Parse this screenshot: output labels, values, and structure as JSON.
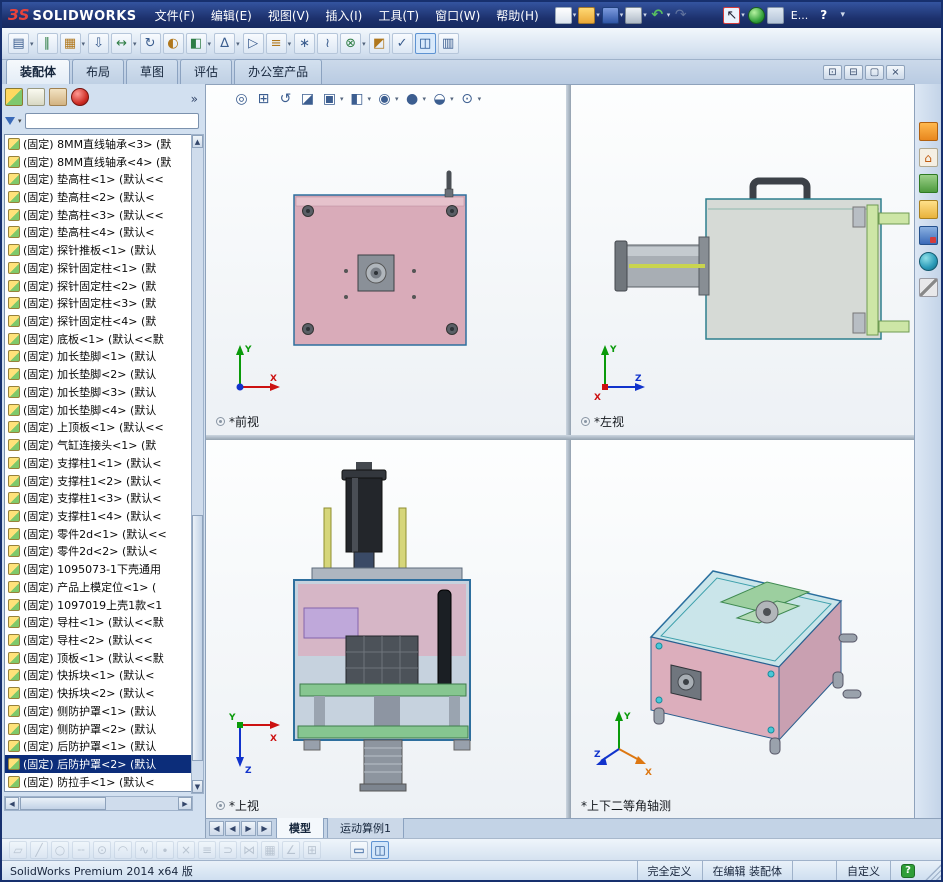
{
  "titlebar": {
    "logo_mark": "ЗS",
    "brand": "SOLIDWORKS",
    "menus": [
      "文件(F)",
      "编辑(E)",
      "视图(V)",
      "插入(I)",
      "工具(T)",
      "窗口(W)",
      "帮助(H)"
    ],
    "quick_icons": [
      {
        "name": "new-document-icon",
        "caret": "▾"
      },
      {
        "name": "open-icon",
        "caret": "▾"
      },
      {
        "name": "save-icon",
        "caret": "▾"
      },
      {
        "name": "print-icon",
        "caret": "▾"
      },
      {
        "name": "undo-icon",
        "glyph": "↶",
        "caret": "▾"
      },
      {
        "name": "redo-icon",
        "glyph": "↷",
        "disabled": true
      }
    ],
    "right_icons": [
      {
        "name": "select-arrow-icon",
        "glyph": "↖",
        "caret": "▾",
        "active": true
      },
      {
        "name": "rebuild-icon"
      },
      {
        "name": "view-settings-icon"
      }
    ],
    "overflow_label": "E...",
    "trailing_icons": [
      {
        "name": "help-icon",
        "glyph": "?"
      },
      {
        "name": "toolbar-flyout-icon",
        "glyph": "▾"
      }
    ]
  },
  "assembly_toolbar": {
    "icons": [
      {
        "name": "insert-components-icon",
        "glyph": "▤",
        "caret": "▾"
      },
      {
        "name": "mate-icon",
        "glyph": "∥"
      },
      {
        "name": "linear-component-pattern-icon",
        "glyph": "▦",
        "caret": "▾"
      },
      {
        "name": "smart-fasteners-icon",
        "glyph": "⇩"
      },
      {
        "name": "move-component-icon",
        "glyph": "↔",
        "caret": "▾"
      },
      {
        "name": "rotate-component-icon",
        "glyph": "↻"
      },
      {
        "name": "show-hidden-components-icon",
        "glyph": "◐"
      },
      {
        "name": "assembly-features-icon",
        "glyph": "◧",
        "caret": "▾"
      },
      {
        "name": "reference-geometry-icon",
        "glyph": "∆",
        "caret": "▾"
      },
      {
        "name": "new-motion-study-icon",
        "glyph": "▷"
      },
      {
        "name": "bill-of-materials-icon",
        "glyph": "≡",
        "caret": "▾"
      },
      {
        "name": "exploded-view-icon",
        "glyph": "∗"
      },
      {
        "name": "explode-line-sketch-icon",
        "glyph": "≀"
      },
      {
        "name": "interference-detection-icon",
        "glyph": "⊗",
        "caret": "▾"
      },
      {
        "name": "assembly-visualization-icon",
        "glyph": "◩"
      },
      {
        "name": "assembly-xpert-icon",
        "glyph": "✓"
      },
      {
        "name": "section-pane-icon",
        "glyph": "◫",
        "active": true
      },
      {
        "name": "pane-display-icon",
        "glyph": "▥"
      }
    ]
  },
  "ribbon_tabs": {
    "items": [
      {
        "label": "装配体",
        "active": true
      },
      {
        "label": "布局"
      },
      {
        "label": "草图"
      },
      {
        "label": "评估"
      },
      {
        "label": "办公室产品"
      }
    ]
  },
  "document_window": {
    "buttons": [
      {
        "name": "restore-window-icon",
        "glyph": "⊡"
      },
      {
        "name": "minimize-window-icon",
        "glyph": "⊟"
      },
      {
        "name": "maximize-window-icon",
        "glyph": "▢"
      },
      {
        "name": "close-window-icon",
        "glyph": "×"
      }
    ]
  },
  "feature_panel": {
    "tabs": [
      {
        "name": "featuremanager-tree-icon"
      },
      {
        "name": "propertymanager-icon"
      },
      {
        "name": "configurationmanager-icon"
      },
      {
        "name": "appearancemanager-icon"
      }
    ],
    "chevron": "»",
    "filter_value": "",
    "tree_items": [
      {
        "label": "(固定) 8MM直线轴承<3> (默"
      },
      {
        "label": "(固定) 8MM直线轴承<4> (默"
      },
      {
        "label": "(固定) 垫高柱<1> (默认<<"
      },
      {
        "label": "(固定) 垫高柱<2> (默认<"
      },
      {
        "label": "(固定) 垫高柱<3> (默认<<"
      },
      {
        "label": "(固定) 垫高柱<4> (默认<"
      },
      {
        "label": "(固定) 探针推板<1> (默认"
      },
      {
        "label": "(固定) 探针固定柱<1> (默"
      },
      {
        "label": "(固定) 探针固定柱<2> (默"
      },
      {
        "label": "(固定) 探针固定柱<3> (默"
      },
      {
        "label": "(固定) 探针固定柱<4> (默"
      },
      {
        "label": "(固定) 底板<1> (默认<<默"
      },
      {
        "label": "(固定) 加长垫脚<1> (默认"
      },
      {
        "label": "(固定) 加长垫脚<2> (默认"
      },
      {
        "label": "(固定) 加长垫脚<3> (默认"
      },
      {
        "label": "(固定) 加长垫脚<4> (默认"
      },
      {
        "label": "(固定) 上顶板<1> (默认<<"
      },
      {
        "label": "(固定) 气缸连接头<1> (默"
      },
      {
        "label": "(固定) 支撑柱1<1> (默认<"
      },
      {
        "label": "(固定) 支撑柱1<2> (默认<"
      },
      {
        "label": "(固定) 支撑柱1<3> (默认<"
      },
      {
        "label": "(固定) 支撑柱1<4> (默认<"
      },
      {
        "label": "(固定) 零件2d<1> (默认<<"
      },
      {
        "label": "(固定) 零件2d<2> (默认<"
      },
      {
        "label": "(固定) 1095073-1下壳通用"
      },
      {
        "label": "(固定) 产品上模定位<1> ("
      },
      {
        "label": "(固定) 1097019上壳1款<1"
      },
      {
        "label": "(固定) 导柱<1> (默认<<默"
      },
      {
        "label": "(固定) 导柱<2> (默认<<"
      },
      {
        "label": "(固定) 顶板<1> (默认<<默"
      },
      {
        "label": "(固定) 快拆块<1> (默认<"
      },
      {
        "label": "(固定) 快拆块<2> (默认<"
      },
      {
        "label": "(固定) 侧防护罩<1> (默认"
      },
      {
        "label": "(固定) 侧防护罩<2> (默认"
      },
      {
        "label": "(固定) 后防护罩<1> (默认"
      },
      {
        "label": "(固定) 后防护罩<2> (默认",
        "selected": true
      },
      {
        "label": "(固定) 防拉手<1> (默认<"
      }
    ]
  },
  "heads_up": {
    "icons": [
      {
        "name": "zoom-fit-icon",
        "glyph": "◎"
      },
      {
        "name": "zoom-area-icon",
        "glyph": "⊞"
      },
      {
        "name": "previous-view-icon",
        "glyph": "↺"
      },
      {
        "name": "section-view-icon",
        "glyph": "◪"
      },
      {
        "name": "view-orientation-icon",
        "glyph": "▣",
        "caret": "▾"
      },
      {
        "name": "display-style-icon",
        "glyph": "◧",
        "caret": "▾"
      },
      {
        "name": "hide-show-items-icon",
        "glyph": "◉",
        "caret": "▾"
      },
      {
        "name": "edit-appearance-icon",
        "glyph": "●",
        "caret": "▾"
      },
      {
        "name": "apply-scene-icon",
        "glyph": "◒",
        "caret": "▾"
      },
      {
        "name": "view-settings-icon",
        "glyph": "⊙",
        "caret": "▾"
      }
    ]
  },
  "viewports": [
    {
      "label": "*前视"
    },
    {
      "label": "*左视"
    },
    {
      "label": "*上视"
    },
    {
      "label": "*上下二等角轴测"
    }
  ],
  "task_pane": {
    "icons": [
      {
        "name": "solidworks-resources-icon"
      },
      {
        "name": "home-icon",
        "glyph": "⌂"
      },
      {
        "name": "design-library-icon"
      },
      {
        "name": "file-explorer-icon"
      },
      {
        "name": "toolbox-icon"
      },
      {
        "name": "appearances-scenes-icon"
      },
      {
        "name": "custom-properties-icon"
      }
    ]
  },
  "model_tabs": {
    "nav": [
      {
        "name": "first-tab-icon",
        "glyph": "◀"
      },
      {
        "name": "prev-tab-icon",
        "glyph": "◀"
      },
      {
        "name": "next-tab-icon",
        "glyph": "▶"
      },
      {
        "name": "last-tab-icon",
        "glyph": "▶"
      }
    ],
    "tabs": [
      {
        "label": "模型",
        "active": true
      },
      {
        "label": "运动算例1"
      }
    ]
  },
  "sketch_toolbar": {
    "icons": [
      {
        "name": "sketch-icon",
        "glyph": "▱",
        "disabled": true
      },
      {
        "name": "line-icon",
        "glyph": "╱",
        "disabled": true
      },
      {
        "name": "circle-icon",
        "glyph": "○",
        "disabled": true
      },
      {
        "name": "centerline-icon",
        "glyph": "╌",
        "disabled": true
      },
      {
        "name": "ellipse-icon",
        "glyph": "⊙",
        "disabled": true
      },
      {
        "name": "arc-icon",
        "glyph": "◠",
        "disabled": true
      },
      {
        "name": "spline-icon",
        "glyph": "∿",
        "disabled": true
      },
      {
        "name": "point-icon",
        "glyph": "∙",
        "disabled": true
      },
      {
        "name": "trim-entities-icon",
        "glyph": "×",
        "disabled": true
      },
      {
        "name": "convert-entities-icon",
        "glyph": "≡",
        "disabled": true
      },
      {
        "name": "offset-entities-icon",
        "glyph": "⊃",
        "disabled": true
      },
      {
        "name": "mirror-entities-icon",
        "glyph": "⋈",
        "disabled": true
      },
      {
        "name": "linear-sketch-pattern-icon",
        "glyph": "▦",
        "disabled": true
      },
      {
        "name": "angle-snap-icon",
        "glyph": "∠",
        "disabled": true
      },
      {
        "name": "grid-icon",
        "glyph": "⊞",
        "disabled": true
      },
      {
        "name": "single-viewport-icon",
        "glyph": "▭"
      },
      {
        "name": "four-viewport-icon",
        "glyph": "◫",
        "active": true
      }
    ]
  },
  "statusbar": {
    "product": "SolidWorks Premium 2014 x64 版",
    "defined_state": "完全定义",
    "edit_state": "在编辑 装配体",
    "custom_label": "自定义"
  }
}
